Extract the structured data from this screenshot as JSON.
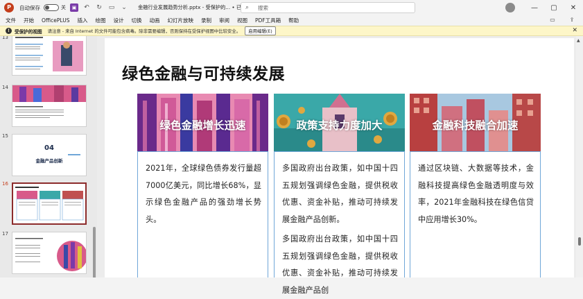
{
  "titlebar": {
    "app_icon": "P",
    "autosave_label": "自动保存",
    "autosave_state": "关",
    "quick_access": [
      "save-icon",
      "undo-icon",
      "redo-icon",
      "present-icon",
      "more-icon"
    ],
    "title": "金融行业发展趋势分析.pptx  -  受保护的...  •  已保存到这台电脑",
    "search_placeholder": "搜索"
  },
  "menu": {
    "items": [
      "文件",
      "开始",
      "OfficePLUS",
      "插入",
      "绘图",
      "设计",
      "切换",
      "动画",
      "幻灯片放映",
      "录制",
      "审阅",
      "视图",
      "PDF工具箱",
      "帮助"
    ]
  },
  "protected_bar": {
    "title": "受保护的视图",
    "message": "请注意 - 来自 Internet 的文件可能包含病毒。除非需要编辑，否则保持在受保护视图中比较安全。",
    "button": "启用编辑(E)"
  },
  "thumbnails": [
    {
      "num": "13",
      "active": false
    },
    {
      "num": "14",
      "active": false
    },
    {
      "num": "15",
      "active": false,
      "big_text": "04",
      "sub_text": "金融产品创新"
    },
    {
      "num": "16",
      "active": true
    },
    {
      "num": "17",
      "active": false
    }
  ],
  "slide": {
    "title": "绿色金融与可持续发展",
    "cards": [
      {
        "heading": "绿色金融增长迅速",
        "paragraphs": [
          "2021年，全球绿色债券发行量超7000亿美元，同比增长68%，显示绿色金融产品的强劲增长势头。"
        ]
      },
      {
        "heading": "政策支持力度加大",
        "paragraphs": [
          "多国政府出台政策，如中国十四五规划强调绿色金融，提供税收优惠、资金补贴，推动可持续发展金融产品创新。",
          "多国政府出台政策，如中国十四五规划强调绿色金融，提供税收优惠、资金补贴，推动可持续发展金融产品创"
        ]
      },
      {
        "heading": "金融科技融合加速",
        "paragraphs": [
          "通过区块链、大数据等技术，金融科技提高绿色金融透明度与效率，2021年金融科技在绿色信贷中应用增长30%。"
        ]
      }
    ]
  },
  "colors": {
    "accent": "#c43e1c",
    "card_border": "#6fa6d8",
    "protected_bar": "#fdf6c8"
  }
}
